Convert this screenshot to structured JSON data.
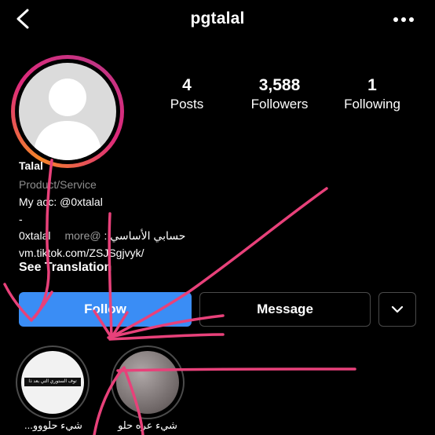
{
  "header": {
    "username": "pgtalal",
    "back_icon": "back-chevron-icon",
    "more_icon": "more-dots-icon"
  },
  "profile": {
    "avatar_icon": "default-avatar-icon"
  },
  "stats": [
    {
      "value": "4",
      "label": "Posts"
    },
    {
      "value": "3,588",
      "label": "Followers"
    },
    {
      "value": "1",
      "label": "Following"
    }
  ],
  "bio": {
    "name": "Talal",
    "category": "Product/Service",
    "line1": "My acc: @0xtalal",
    "line2": "-",
    "line3_left": "0xtalal",
    "line3_more": "more@",
    "line3_right": "حسابي الأساسي :",
    "link": "vm.tiktok.com/ZSJSgjvyk/",
    "see_translation": "See Translation"
  },
  "buttons": {
    "follow": "Follow",
    "message": "Message",
    "dropdown_icon": "chevron-down-icon"
  },
  "highlights": [
    {
      "label": "شيء حلووو...",
      "caption": "توف الستوري التي بعد ذا"
    },
    {
      "label": "شيء عره حلو",
      "caption": ""
    }
  ],
  "colors": {
    "background": "#000000",
    "follow_button": "#3a8df5",
    "scribble": "#e8417a",
    "ring": "#dd2a7b"
  }
}
